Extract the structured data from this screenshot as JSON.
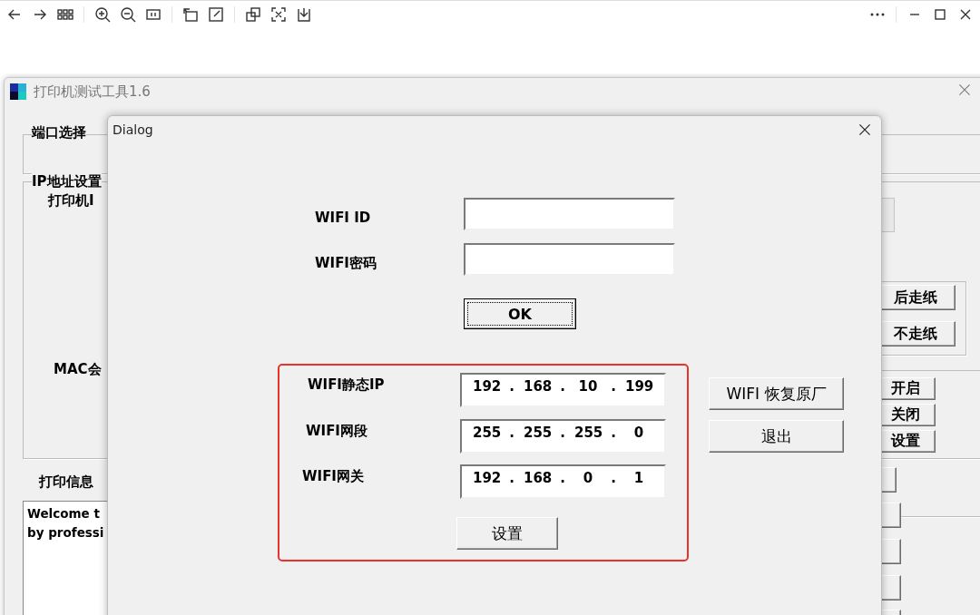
{
  "app_window": {
    "title": "打印机测试工具1.6",
    "groups": [
      {
        "label": "端口选择"
      },
      {
        "label": "IP地址设置"
      }
    ],
    "labels": [
      "打印机I",
      "MAC会"
    ],
    "print_info": {
      "label": "打印信息",
      "log_lines": [
        "Welcome t",
        "by professi"
      ]
    },
    "right_buttons": [
      "后走纸",
      "不走纸",
      "开启",
      "关闭",
      "设置"
    ]
  },
  "dialog": {
    "title": "Dialog",
    "fields": [
      {
        "label": "WIFI ID"
      },
      {
        "label": "WIFI密码"
      }
    ],
    "ok_button": {
      "label": "OK",
      "focused": true
    },
    "static_ip": {
      "highlighted": true,
      "separator": ".",
      "rows": [
        {
          "label": "WIFI静态IP",
          "octets": [
            "192",
            "168",
            "10",
            "199"
          ]
        },
        {
          "label": "WIFI网段",
          "octets": [
            "255",
            "255",
            "255",
            "0"
          ]
        },
        {
          "label": "WIFI网关",
          "octets": [
            "192",
            "168",
            "0",
            "1"
          ]
        }
      ],
      "set_button": "设置"
    },
    "side_buttons": [
      "WIFI 恢复原厂",
      "退出"
    ]
  }
}
